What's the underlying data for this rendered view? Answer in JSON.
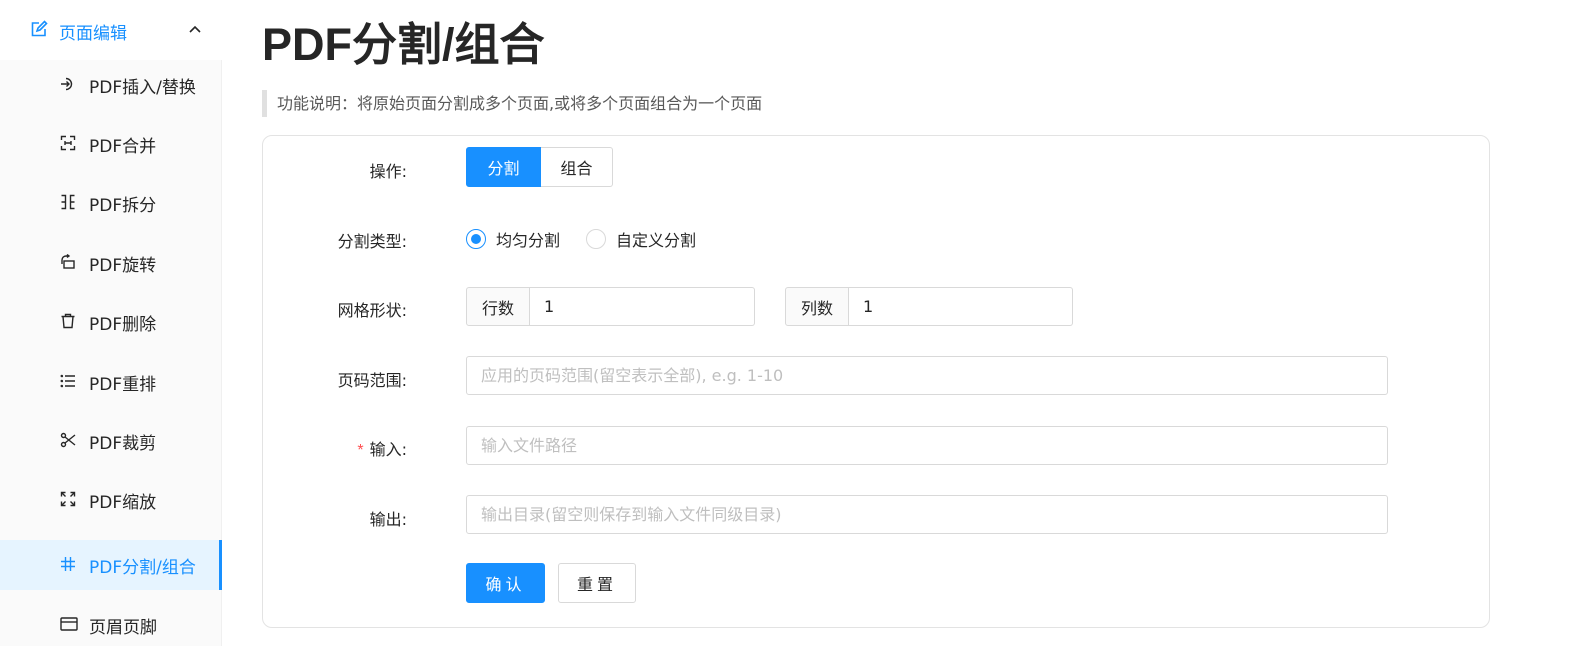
{
  "sidebar": {
    "submenu": {
      "label": "页面编辑",
      "icon": "edit-icon"
    },
    "items": [
      {
        "label": "PDF插入/替换",
        "icon": "insert-icon"
      },
      {
        "label": "PDF合并",
        "icon": "merge-icon"
      },
      {
        "label": "PDF拆分",
        "icon": "split-icon"
      },
      {
        "label": "PDF旋转",
        "icon": "rotate-icon"
      },
      {
        "label": "PDF删除",
        "icon": "trash-icon"
      },
      {
        "label": "PDF重排",
        "icon": "list-icon"
      },
      {
        "label": "PDF裁剪",
        "icon": "scissors-icon"
      },
      {
        "label": "PDF缩放",
        "icon": "scale-icon"
      },
      {
        "label": "PDF分割/组合",
        "icon": "grid-icon",
        "active": true
      },
      {
        "label": "页眉页脚",
        "icon": "header-footer-icon"
      }
    ]
  },
  "main": {
    "title": "PDF分割/组合",
    "description": "功能说明：将原始页面分割成多个页面,或将多个页面组合为一个页面",
    "form": {
      "operation": {
        "label": "操作:",
        "options": [
          "分割",
          "组合"
        ],
        "selected": "分割"
      },
      "split_type": {
        "label": "分割类型:",
        "options": [
          "均匀分割",
          "自定义分割"
        ],
        "selected": "均匀分割"
      },
      "grid": {
        "label": "网格形状:",
        "rows_label": "行数",
        "rows_value": "1",
        "cols_label": "列数",
        "cols_value": "1"
      },
      "page_range": {
        "label": "页码范围:",
        "value": "",
        "placeholder": "应用的页码范围(留空表示全部), e.g. 1-10"
      },
      "input": {
        "required_mark": "*",
        "label": "输入:",
        "value": "",
        "placeholder": "输入文件路径"
      },
      "output": {
        "label": "输出:",
        "value": "",
        "placeholder": "输出目录(留空则保存到输入文件同级目录)"
      },
      "confirm_label": "确认",
      "reset_label": "重置"
    }
  },
  "colors": {
    "accent": "#1890ff",
    "active_bg": "#e6f4ff",
    "required": "#ff4d4f"
  }
}
